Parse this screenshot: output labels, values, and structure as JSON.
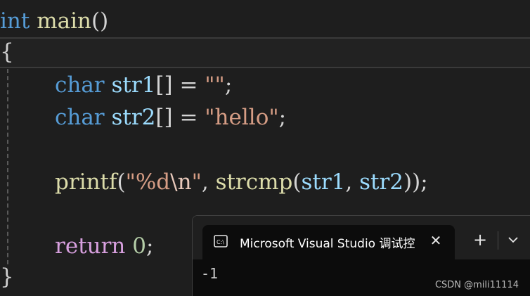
{
  "editor": {
    "lines": {
      "l1": {
        "kw": "int",
        "name": "main",
        "parens": "()"
      },
      "l2": {
        "brace": "{"
      },
      "l3": {
        "kw": "char",
        "name": "str1",
        "rest": "[] = ",
        "str": "\"\"",
        "end": ";"
      },
      "l4": {
        "kw": "char",
        "name": "str2",
        "rest": "[] = ",
        "str": "\"hello\"",
        "end": ";"
      },
      "l6": {
        "fn": "printf",
        "open": "(",
        "str1": "\"%d",
        "esc": "\\n",
        "str2": "\"",
        "comma": ", ",
        "fn2": "strcmp",
        "open2": "(",
        "a": "str1",
        "sep": ", ",
        "b": "str2",
        "close": "));"
      },
      "l8": {
        "kw": "return",
        "num": "0",
        "end": ";"
      },
      "l9": {
        "brace": "}"
      }
    }
  },
  "terminal": {
    "tab_title": "Microsoft Visual Studio 调试控制台",
    "close_glyph": "✕",
    "new_tab_glyph": "+",
    "output": "-1"
  },
  "watermark": "CSDN @mili11114",
  "icons": [
    "console-icon",
    "close-icon",
    "plus-icon",
    "chevron-down-icon"
  ],
  "colors": {
    "keyword": "#569cd6",
    "function": "#dcdcaa",
    "variable": "#9cdcfe",
    "string": "#d69d85",
    "control": "#d8a0df",
    "number": "#b5cea8"
  }
}
